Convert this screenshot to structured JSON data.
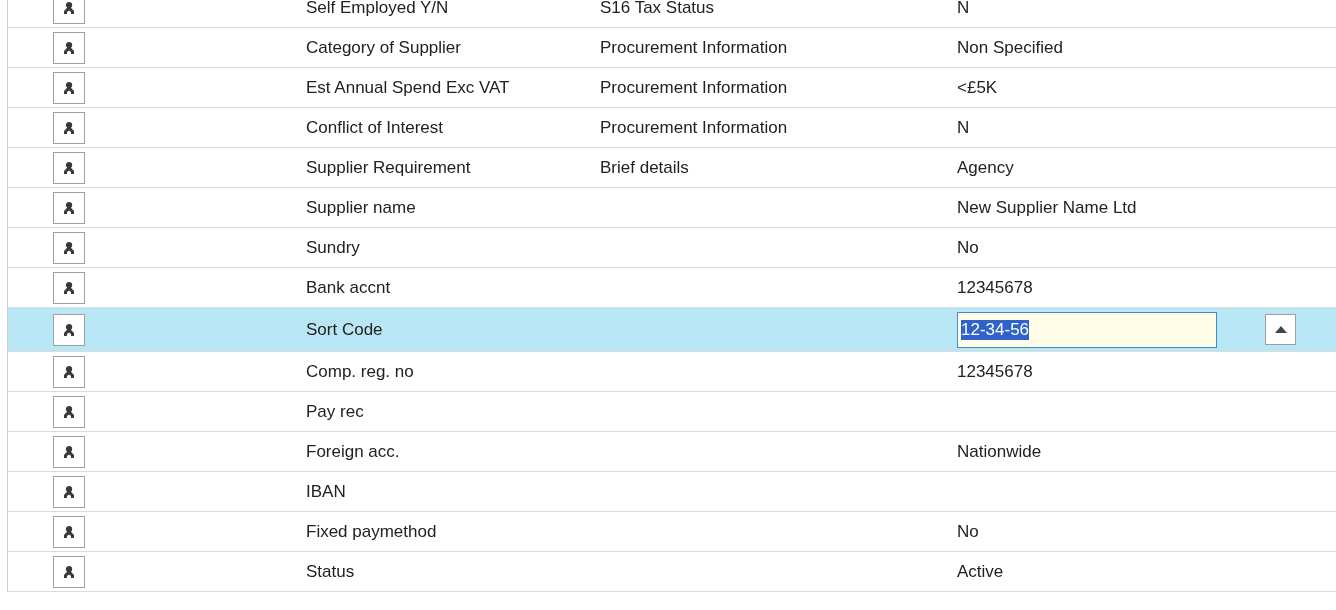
{
  "rows": [
    {
      "label": "Self Employed Y/N",
      "section": "S16 Tax Status",
      "value": "N",
      "selected": false
    },
    {
      "label": "Category of Supplier",
      "section": "Procurement Information",
      "value": "Non Specified",
      "selected": false
    },
    {
      "label": "Est Annual Spend Exc VAT",
      "section": "Procurement Information",
      "value": "<£5K",
      "selected": false
    },
    {
      "label": "Conflict of Interest",
      "section": "Procurement Information",
      "value": "N",
      "selected": false
    },
    {
      "label": "Supplier Requirement",
      "section": "Brief details",
      "value": "Agency",
      "selected": false
    },
    {
      "label": "Supplier name",
      "value": "New Supplier Name Ltd",
      "selected": false
    },
    {
      "label": "Sundry",
      "value": "No",
      "selected": false
    },
    {
      "label": "Bank accnt",
      "value": "12345678",
      "selected": false
    },
    {
      "label": "Sort Code",
      "value": "12-34-56",
      "selected": true
    },
    {
      "label": "Comp. reg. no",
      "value": "12345678",
      "selected": false
    },
    {
      "label": "Pay rec",
      "selected": false
    },
    {
      "label": "Foreign acc.",
      "value": "Nationwide",
      "selected": false
    },
    {
      "label": "IBAN",
      "selected": false
    },
    {
      "label": "Fixed paymethod",
      "value": "No",
      "selected": false
    },
    {
      "label": "Status",
      "value": "Active",
      "selected": false
    }
  ]
}
